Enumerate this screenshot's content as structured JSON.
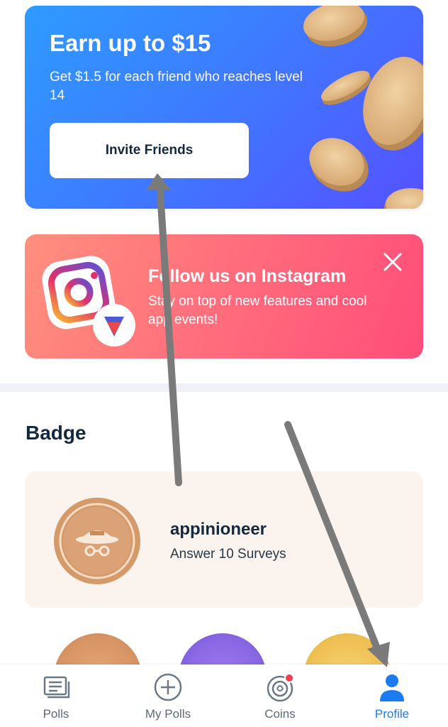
{
  "invite_card": {
    "title": "Earn up to $15",
    "subtitle": "Get $1.5 for each friend who reaches level 14",
    "button_label": "Invite Friends",
    "gradient_start": "#2e9bff",
    "gradient_end": "#5551ff"
  },
  "instagram_card": {
    "title": "Follow us on Instagram",
    "subtitle": "Stay on top of new features and cool app events!",
    "close_icon": "close-icon"
  },
  "badge_section": {
    "heading": "Badge",
    "featured": {
      "name": "appinioneer",
      "description": "Answer 10 Surveys"
    }
  },
  "bottom_nav": {
    "items": [
      {
        "label": "Polls",
        "icon": "polls-icon"
      },
      {
        "label": "My Polls",
        "icon": "add-circle-icon"
      },
      {
        "label": "Coins",
        "icon": "coins-icon"
      },
      {
        "label": "Profile",
        "icon": "person-icon"
      }
    ],
    "active_color": "#1a7cf0"
  }
}
